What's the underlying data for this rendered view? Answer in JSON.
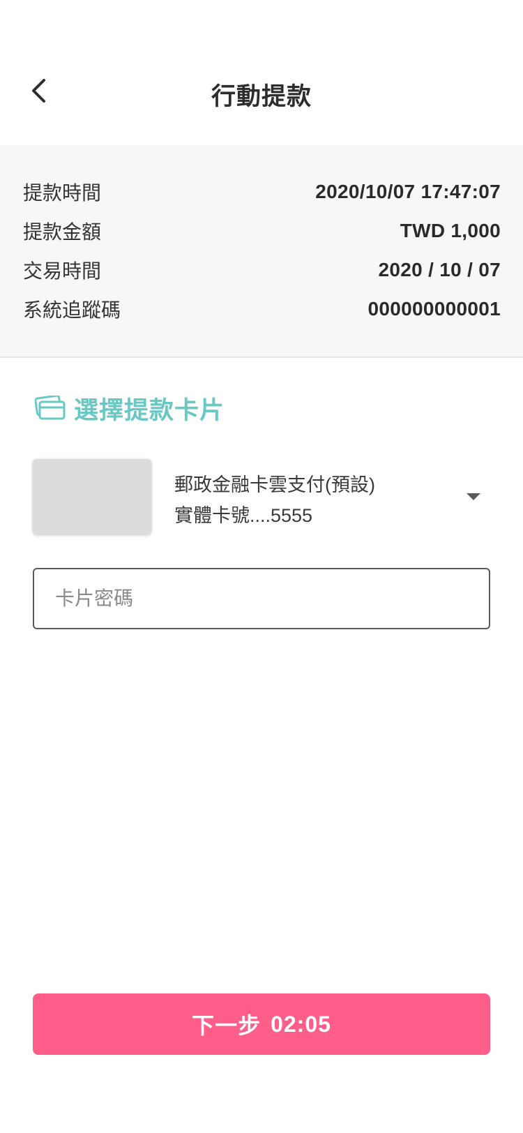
{
  "header": {
    "title": "行動提款",
    "back_icon": "chevron-left-icon"
  },
  "info": {
    "rows": [
      {
        "label": "提款時間",
        "value": "2020/10/07 17:47:07"
      },
      {
        "label": "提款金額",
        "value": "TWD 1,000"
      },
      {
        "label": "交易時間",
        "value": "2020 / 10 / 07"
      },
      {
        "label": "系統追蹤碼",
        "value": "000000000001"
      }
    ]
  },
  "card_section": {
    "title": "選擇提款卡片",
    "icon": "credit-card-icon",
    "accent_color": "#67c8c4",
    "selected_card": {
      "name": "郵政金融卡雲支付(預設)",
      "number": "實體卡號....5555"
    },
    "password_placeholder": "卡片密碼"
  },
  "actions": {
    "next_label": "下一步",
    "countdown": "02:05",
    "button_color": "#ff5d8a"
  }
}
